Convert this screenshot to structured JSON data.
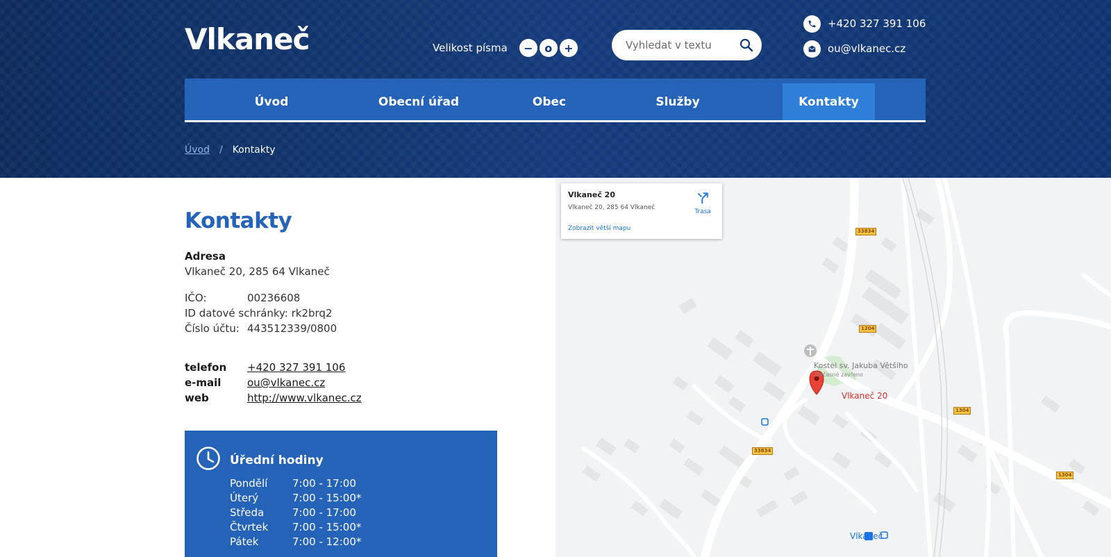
{
  "site": {
    "logo": "Vlkaneč"
  },
  "font_size": {
    "label": "Velikost písma",
    "decrease": "−",
    "reset": "o",
    "increase": "+"
  },
  "search": {
    "placeholder": "Vyhledat v textu"
  },
  "header_contact": {
    "phone": "+420 327 391 106",
    "email": "ou@vlkanec.cz"
  },
  "nav": {
    "items": [
      {
        "label": "Úvod"
      },
      {
        "label": "Obecní úřad"
      },
      {
        "label": "Obec"
      },
      {
        "label": "Služby"
      },
      {
        "label": "Kontakty",
        "active": true
      }
    ]
  },
  "breadcrumb": {
    "home": "Úvod",
    "separator": "/",
    "current": "Kontakty"
  },
  "page": {
    "title": "Kontakty",
    "address_heading": "Adresa",
    "address": "Vlkaneč 20, 285 64 Vlkaneč",
    "ico_label": "IČO:",
    "ico_value": "00236608",
    "ds_label": "ID datové schránky:",
    "ds_value": "rk2brq2",
    "account_label": "Číslo účtu:",
    "account_value": "443512339/0800",
    "phone_label": "telefon",
    "phone_value": "+420 327 391 106",
    "email_label": "e-mail",
    "email_value": "ou@vlkanec.cz",
    "web_label": "web",
    "web_value": "http://www.vlkanec.cz"
  },
  "hours": {
    "title": "Úřední hodiny",
    "rows": [
      {
        "day": "Pondělí",
        "time": "7:00 - 17:00"
      },
      {
        "day": "Úterý",
        "time": "7:00 - 15:00*"
      },
      {
        "day": "Středa",
        "time": "7:00 - 17:00"
      },
      {
        "day": "Čtvrtek",
        "time": "7:00 - 15:00*"
      },
      {
        "day": "Pátek",
        "time": "7:00 - 12:00*"
      }
    ]
  },
  "map": {
    "card_title": "Vlkaneč 20",
    "card_address": "Vlkaneč 20, 285 64 Vlkaneč",
    "directions_label": "Trasa",
    "larger_map_link": "Zobrazit větší mapu",
    "poi_church": "Kostel sv. Jakuba Většího",
    "poi_church_note": "Dočasně zavřeno",
    "pin_label": "Vlkaneč 20",
    "station_label": "Vlkaneč",
    "road_labels": [
      "33834",
      "1204",
      "1304",
      "33834",
      "1304"
    ]
  },
  "colors": {
    "primary": "#2563b8",
    "active_tab": "#2f7fd9",
    "header_dark": "#0c2a5c"
  }
}
